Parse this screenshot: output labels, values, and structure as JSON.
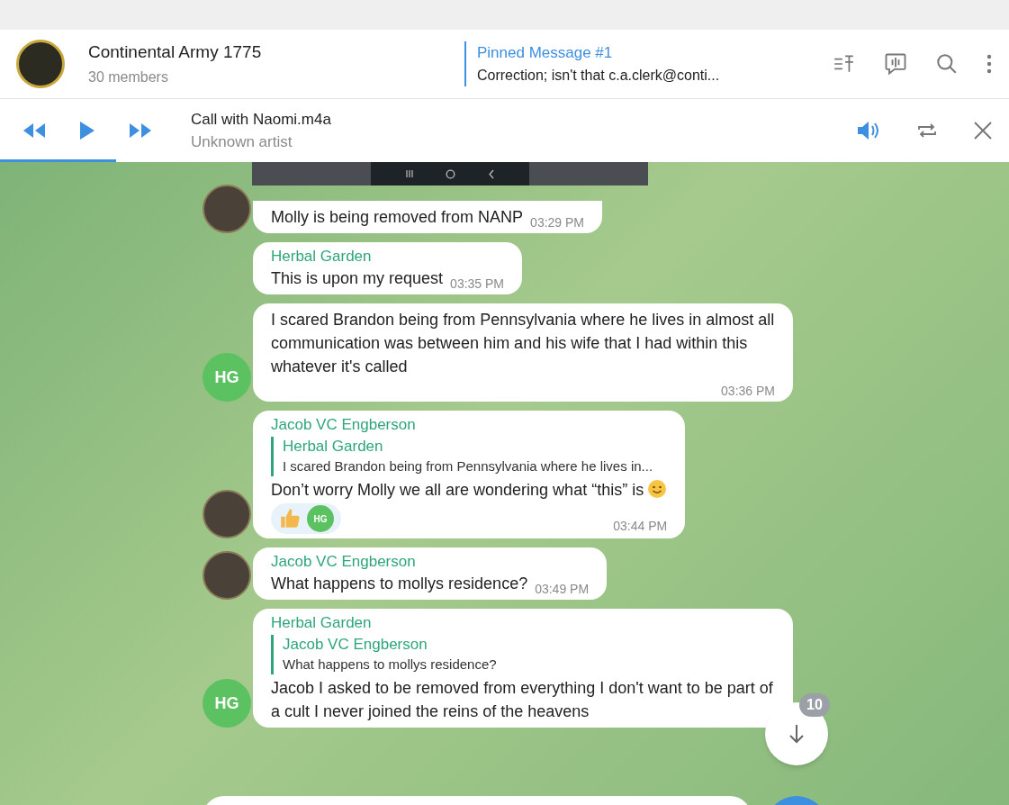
{
  "chat": {
    "title": "Continental Army 1775",
    "subtitle": "30 members"
  },
  "pinned": {
    "label": "Pinned Message #1",
    "text": "Correction; isn't that c.a.clerk@conti..."
  },
  "player": {
    "title": "Call with Naomi.m4a",
    "artist": "Unknown artist",
    "progress": {
      "level": 0.115
    }
  },
  "messages": [
    {
      "avatar": {
        "kind": "photo"
      },
      "text": "Molly is being removed from NANP",
      "time": "03:29 PM"
    },
    {
      "sender": "Herbal Garden",
      "text": "This is upon my request",
      "time": "03:35 PM"
    },
    {
      "avatar": {
        "kind": "initials",
        "initials": "HG",
        "color": "#5cc160"
      },
      "text": "I scared Brandon being from Pennsylvania where he lives in almost all communication was between him and his wife that I had within this whatever it's called",
      "time": "03:36 PM"
    },
    {
      "sender": "Jacob VC Engberson",
      "avatar": {
        "kind": "photo"
      },
      "reply": {
        "sender": "Herbal Garden",
        "text": "I scared Brandon being from Pennsylvania where he lives in..."
      },
      "text": "Don’t worry Molly we all are wondering what “this” is",
      "smile": true,
      "reactions": [
        {
          "initials": "HG"
        }
      ],
      "time": "03:44 PM"
    },
    {
      "sender": "Jacob VC Engberson",
      "avatar": {
        "kind": "photo"
      },
      "text": "What happens to mollys residence?",
      "time": "03:49 PM"
    },
    {
      "sender": "Herbal Garden",
      "avatar": {
        "kind": "initials",
        "initials": "HG",
        "color": "#5cc160"
      },
      "reply": {
        "sender": "Jacob VC Engberson",
        "text": "What happens to mollys residence?"
      },
      "text": "Jacob I asked to be removed from everything I don't want to be part of a cult I never joined the reins of the heavens"
    }
  ],
  "scroll_down": {
    "count": "10"
  }
}
